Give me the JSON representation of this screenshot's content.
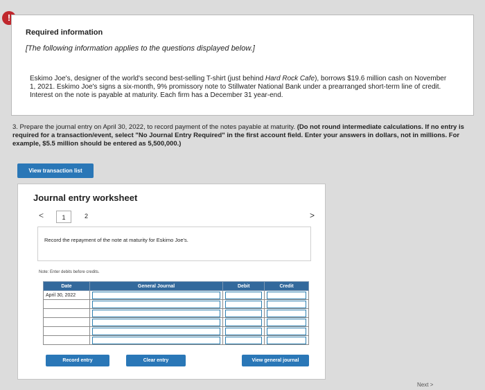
{
  "alert": {
    "icon": "!"
  },
  "info": {
    "title": "Required information",
    "subtitle": "[The following information applies to the questions displayed below.]",
    "paragraph_plain": "Eskimo Joe's, designer of the world's second best-selling T-shirt (just behind ",
    "paragraph_italic": "Hard Rock Cafe",
    "paragraph_rest": "), borrows $19.6 million cash on November 1, 2021. Eskimo Joe's signs a six-month, 9% promissory note to Stillwater National Bank under a prearranged short-term line of credit. Interest on the note is payable at maturity. Each firm has a December 31 year-end."
  },
  "question": {
    "text": "3. Prepare the journal entry on April 30, 2022, to record payment of the notes payable at maturity. ",
    "bold_text": "(Do not round intermediate calculations. If no entry is required for a transaction/event, select \"No Journal Entry Required\" in the first account field. Enter your answers in dollars, not in millions. For example, $5.5 million should be entered as 5,500,000.)"
  },
  "buttons": {
    "view_transactions": "View transaction list",
    "record_entry": "Record entry",
    "clear_entry": "Clear entry",
    "view_general_journal": "View general journal"
  },
  "worksheet": {
    "title": "Journal entry worksheet",
    "prev": "<",
    "next": ">",
    "pages": [
      "1",
      "2"
    ],
    "instruction": "Record the repayment of the note at maturity for Eskimo Joe's.",
    "note": "Note: Enter debits before credits.",
    "columns": [
      "Date",
      "General Journal",
      "Debit",
      "Credit"
    ],
    "first_date": "April 30, 2022"
  },
  "footer": {
    "next": "Next",
    "next_arrow": ">"
  }
}
